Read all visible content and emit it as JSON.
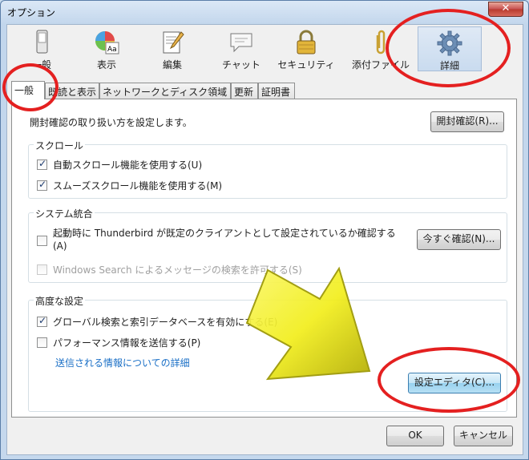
{
  "window": {
    "title": "オプション",
    "close_glyph": "✕"
  },
  "toolbar": {
    "items": [
      {
        "label": "一般",
        "icon": "phone-icon"
      },
      {
        "label": "表示",
        "icon": "palette-icon"
      },
      {
        "label": "編集",
        "icon": "pencil-document-icon"
      },
      {
        "label": "チャット",
        "icon": "chat-bubble-icon"
      },
      {
        "label": "セキュリティ",
        "icon": "lock-icon"
      },
      {
        "label": "添付ファイル",
        "icon": "paperclip-icon"
      },
      {
        "label": "詳細",
        "icon": "gear-icon",
        "selected": true
      }
    ]
  },
  "tabs": [
    "一般",
    "既読と表示",
    "ネットワークとディスク領域",
    "更新",
    "証明書"
  ],
  "general": {
    "receipt_text": "開封確認の取り扱い方を設定します。",
    "receipt_button": "開封確認(R)...",
    "scroll": {
      "title": "スクロール",
      "auto_scroll": "自動スクロール機能を使用する(U)",
      "smooth_scroll": "スムーズスクロール機能を使用する(M)"
    },
    "system": {
      "title": "システム統合",
      "default_check_line1": "起動時に Thunderbird が既定のクライアントとして設定されているか確認する",
      "default_check_line2": "(A)",
      "check_now_button": "今すぐ確認(N)...",
      "windows_search": "Windows Search によるメッセージの検索を許可する(S)"
    },
    "advanced": {
      "title": "高度な設定",
      "global_search": "グローバル検索と索引データベースを有効にする(E)",
      "performance": "パフォーマンス情報を送信する(P)",
      "details_link": "送信される情報についての詳細",
      "config_editor_button": "設定エディタ(C)..."
    }
  },
  "footer": {
    "ok": "OK",
    "cancel": "キャンセル"
  },
  "colors": {
    "annotation_red": "#e42020",
    "arrow_yellow": "#f2ee1c"
  }
}
